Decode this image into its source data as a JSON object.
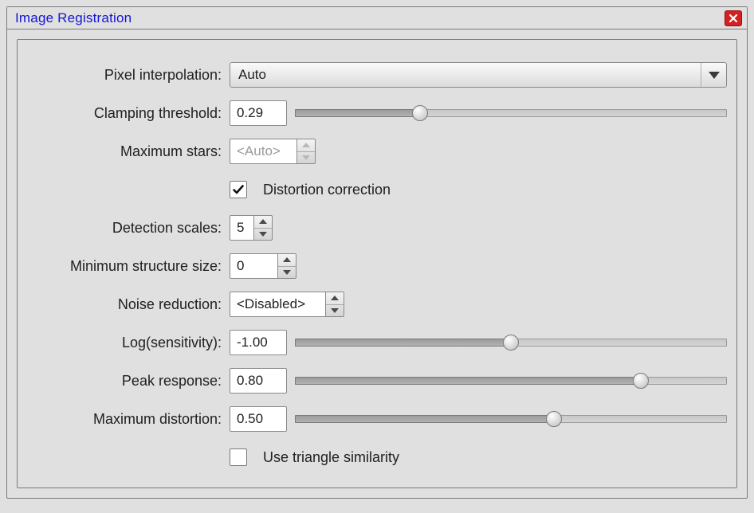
{
  "title": "Image Registration",
  "fields": {
    "pixel_interpolation": {
      "label": "Pixel interpolation:",
      "value": "Auto"
    },
    "clamping_threshold": {
      "label": "Clamping threshold:",
      "value": "0.29",
      "slider_pct": 29
    },
    "maximum_stars": {
      "label": "Maximum stars:",
      "value": "<Auto>",
      "disabled": true
    },
    "distortion_correction": {
      "label": "Distortion correction",
      "checked": true
    },
    "detection_scales": {
      "label": "Detection scales:",
      "value": "5"
    },
    "min_structure_size": {
      "label": "Minimum structure size:",
      "value": "0"
    },
    "noise_reduction": {
      "label": "Noise reduction:",
      "value": "<Disabled>"
    },
    "log_sensitivity": {
      "label": "Log(sensitivity):",
      "value": "-1.00",
      "slider_pct": 50
    },
    "peak_response": {
      "label": "Peak response:",
      "value": "0.80",
      "slider_pct": 80
    },
    "maximum_distortion": {
      "label": "Maximum distortion:",
      "value": "0.50",
      "slider_pct": 60
    },
    "triangle_similarity": {
      "label": "Use triangle similarity",
      "checked": false
    }
  }
}
